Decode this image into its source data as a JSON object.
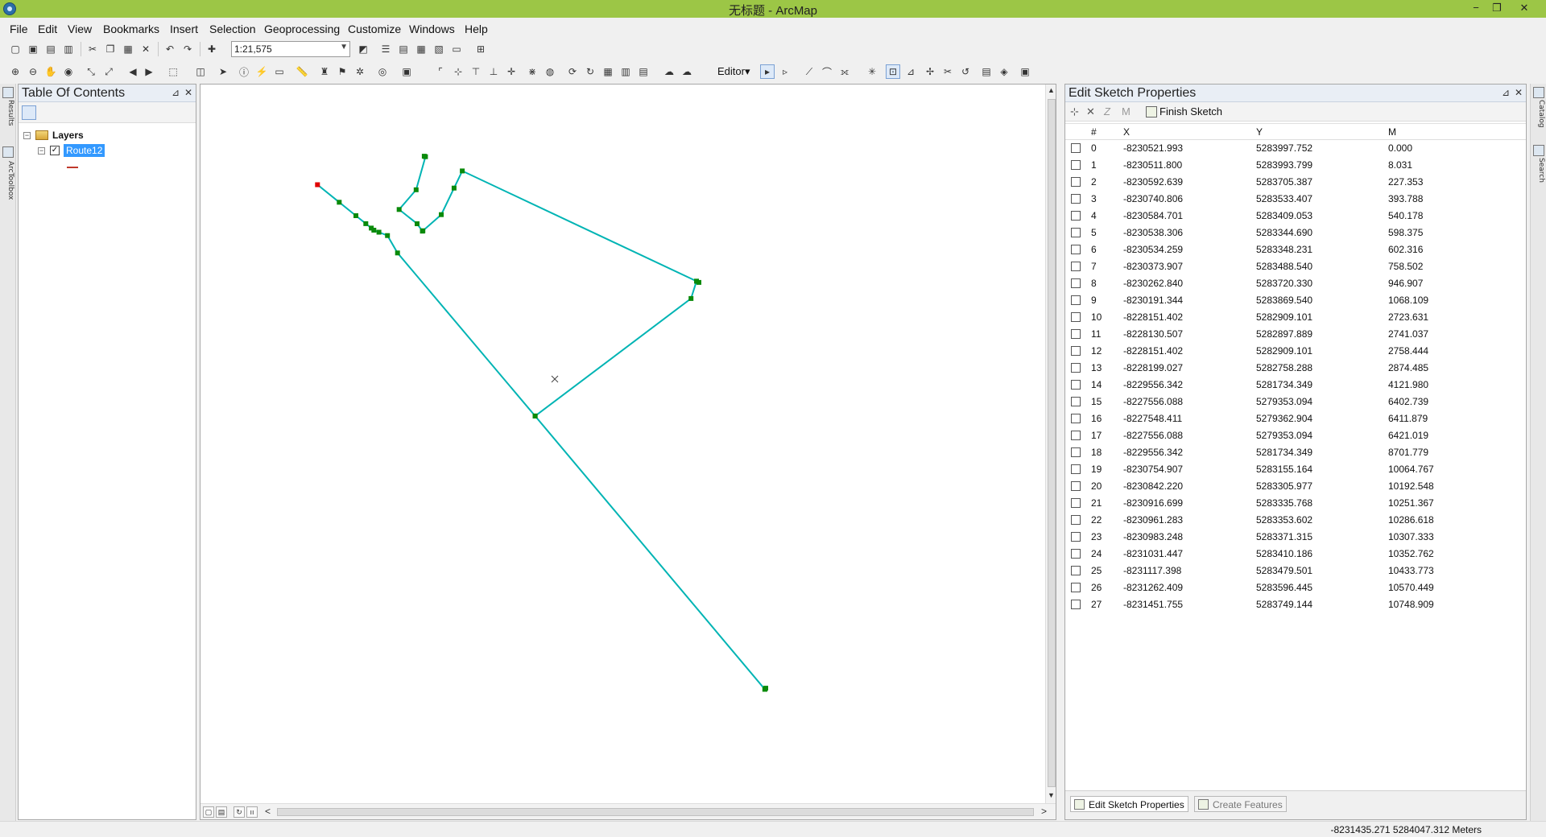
{
  "window": {
    "title": "无标题 - ArcMap",
    "minimize_glyph": "−",
    "restore_glyph": "❐",
    "close_glyph": "✕"
  },
  "menu": [
    "File",
    "Edit",
    "View",
    "Bookmarks",
    "Insert",
    "Selection",
    "Geoprocessing",
    "Customize",
    "Windows",
    "Help"
  ],
  "toolbar": {
    "scale": "1:21,575",
    "editor_label": "Editor▾"
  },
  "left_dock": {
    "tab1": "Results",
    "tab2": "ArcToolbox"
  },
  "right_dock": {
    "tab1": "Catalog",
    "tab2": "Search"
  },
  "toc": {
    "title": "Table Of Contents",
    "pin_glyph": "⊿",
    "close_glyph": "✕",
    "root_label": "Layers",
    "layer_label": "Route12",
    "expander_glyph": "−",
    "check_glyph": "✓"
  },
  "sketch_panel": {
    "title": "Edit Sketch Properties",
    "pin_glyph": "⊿",
    "close_glyph": "✕",
    "delete_glyph": "✕",
    "z_glyph": "Z",
    "m_glyph": "M",
    "finish_label": "Finish Sketch",
    "columns": [
      "#",
      "X",
      "Y",
      "M"
    ],
    "vertices": [
      [
        "0",
        "-8230521.993",
        "5283997.752",
        "0.000"
      ],
      [
        "1",
        "-8230511.800",
        "5283993.799",
        "8.031"
      ],
      [
        "2",
        "-8230592.639",
        "5283705.387",
        "227.353"
      ],
      [
        "3",
        "-8230740.806",
        "5283533.407",
        "393.788"
      ],
      [
        "4",
        "-8230584.701",
        "5283409.053",
        "540.178"
      ],
      [
        "5",
        "-8230538.306",
        "5283344.690",
        "598.375"
      ],
      [
        "6",
        "-8230534.259",
        "5283348.231",
        "602.316"
      ],
      [
        "7",
        "-8230373.907",
        "5283488.540",
        "758.502"
      ],
      [
        "8",
        "-8230262.840",
        "5283720.330",
        "946.907"
      ],
      [
        "9",
        "-8230191.344",
        "5283869.540",
        "1068.109"
      ],
      [
        "10",
        "-8228151.402",
        "5282909.101",
        "2723.631"
      ],
      [
        "11",
        "-8228130.507",
        "5282897.889",
        "2741.037"
      ],
      [
        "12",
        "-8228151.402",
        "5282909.101",
        "2758.444"
      ],
      [
        "13",
        "-8228199.027",
        "5282758.288",
        "2874.485"
      ],
      [
        "14",
        "-8229556.342",
        "5281734.349",
        "4121.980"
      ],
      [
        "15",
        "-8227556.088",
        "5279353.094",
        "6402.739"
      ],
      [
        "16",
        "-8227548.411",
        "5279362.904",
        "6411.879"
      ],
      [
        "17",
        "-8227556.088",
        "5279353.094",
        "6421.019"
      ],
      [
        "18",
        "-8229556.342",
        "5281734.349",
        "8701.779"
      ],
      [
        "19",
        "-8230754.907",
        "5283155.164",
        "10064.767"
      ],
      [
        "20",
        "-8230842.220",
        "5283305.977",
        "10192.548"
      ],
      [
        "21",
        "-8230916.699",
        "5283335.768",
        "10251.367"
      ],
      [
        "22",
        "-8230961.283",
        "5283353.602",
        "10286.618"
      ],
      [
        "23",
        "-8230983.248",
        "5283371.315",
        "10307.333"
      ],
      [
        "24",
        "-8231031.447",
        "5283410.186",
        "10352.762"
      ],
      [
        "25",
        "-8231117.398",
        "5283479.501",
        "10433.773"
      ],
      [
        "26",
        "-8231262.409",
        "5283596.445",
        "10570.449"
      ],
      [
        "27",
        "-8231451.755",
        "5283749.144",
        "10748.909"
      ]
    ],
    "tabs": [
      "Edit Sketch Properties",
      "Create Features"
    ]
  },
  "map": {
    "line_color": "#00b4b4",
    "vertex_color": "#0a8a0a",
    "selected_vertex_color": "#e00000",
    "scroll_left": "<",
    "scroll_right": ">",
    "scroll_up": "▲",
    "scroll_down": "▼",
    "pause_glyph": "ıı",
    "refresh_glyph": "↻"
  },
  "status": {
    "coordinates": "-8231435.271  5284047.312 Meters"
  }
}
